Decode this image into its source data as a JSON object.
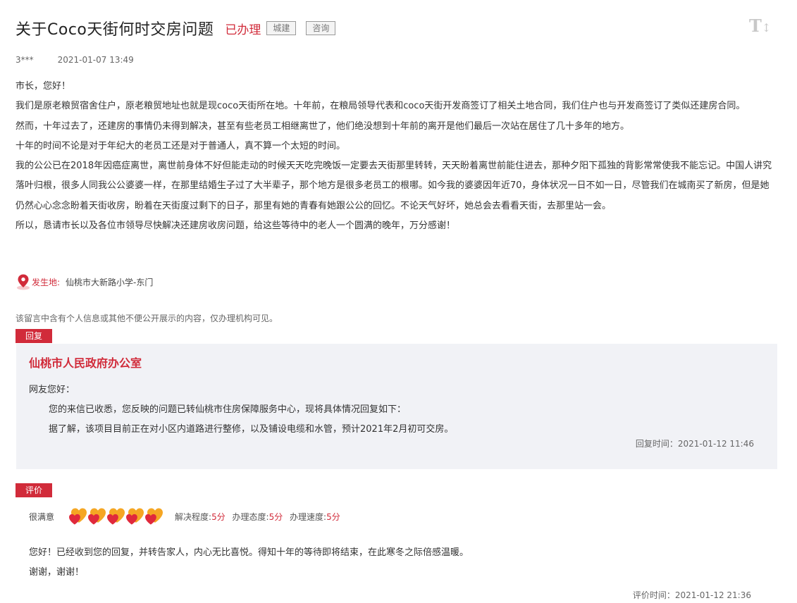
{
  "header": {
    "title": "关于Coco天街何时交房问题",
    "status": "已办理",
    "tags": [
      "城建",
      "咨询"
    ],
    "font_size_toggle": "T",
    "font_size_icon": "text-size-icon"
  },
  "meta": {
    "author": "3***",
    "datetime": "2021-01-07 13:49"
  },
  "message": {
    "paragraphs": [
      "市长，您好！",
      "我们是原老粮贸宿舍住户，原老粮贸地址也就是现coco天街所在地。十年前，在粮局领导代表和coco天街开发商签订了相关土地合同，我们住户也与开发商签订了类似还建房合同。",
      "然而，十年过去了，还建房的事情仍未得到解决，甚至有些老员工相继离世了，他们绝没想到十年前的离开是他们最后一次站在居住了几十多年的地方。",
      "十年的时间不论是对于年纪大的老员工还是对于普通人，真不算一个太短的时间。",
      "我的公公已在2018年因癌症离世，离世前身体不好但能走动的时候天天吃完晚饭一定要去天街那里转转，天天盼着离世前能住进去，那种夕阳下孤独的背影常常使我不能忘记。中国人讲究落叶归根，很多人同我公公婆婆一样，在那里结婚生子过了大半辈子，那个地方是很多老员工的根哪。如今我的婆婆因年近70，身体状况一日不如一日，尽管我们在城南买了新房，但是她仍然心心念念盼着天街收房，盼着在天街度过剩下的日子，那里有她的青春有她跟公公的回忆。不论天气好坏，她总会去看看天街，去那里站一会。",
      "所以，恳请市长以及各位市领导尽快解决还建房收房问题，给这些等待中的老人一个圆满的晚年，万分感谢！"
    ],
    "location_label": "发生地:",
    "location_value": "仙桃市大新路小学-东门",
    "location_icon": "map-pin-icon"
  },
  "privacy_note": "该留言中含有个人信息或其他不便公开展示的内容，仅办理机构可见。",
  "reply": {
    "section_label": "回复",
    "org": "仙桃市人民政府办公室",
    "greeting": "网友您好：",
    "lines": [
      "您的来信已收悉，您反映的问题已转仙桃市住房保障服务中心，现将具体情况回复如下：",
      "据了解，该项目目前正在对小区内道路进行整修，以及铺设电缆和水管，预计2021年2月初可交房。"
    ],
    "time_label": "回复时间：",
    "time": "2021-01-12 11:46"
  },
  "evaluation": {
    "section_label": "评价",
    "overall": "很满意",
    "hearts": 5,
    "heart_icon": "heart-rating-icon",
    "scores": [
      {
        "label": "解决程度:",
        "value": "5分"
      },
      {
        "label": "办理态度:",
        "value": "5分"
      },
      {
        "label": "办理速度:",
        "value": "5分"
      }
    ],
    "comment_lines": [
      "您好！已经收到您的回复，并转告家人，内心无比喜悦。得知十年的等待即将结束，在此寒冬之际倍感温暖。",
      "谢谢，谢谢！"
    ],
    "time_label": "评价时间：",
    "time": "2021-01-12 21:36"
  },
  "colors": {
    "accent": "#d12b3a",
    "reply_bg": "#f1f2f6",
    "heart_outer": "#f5a623",
    "heart_inner": "#e0293c"
  }
}
